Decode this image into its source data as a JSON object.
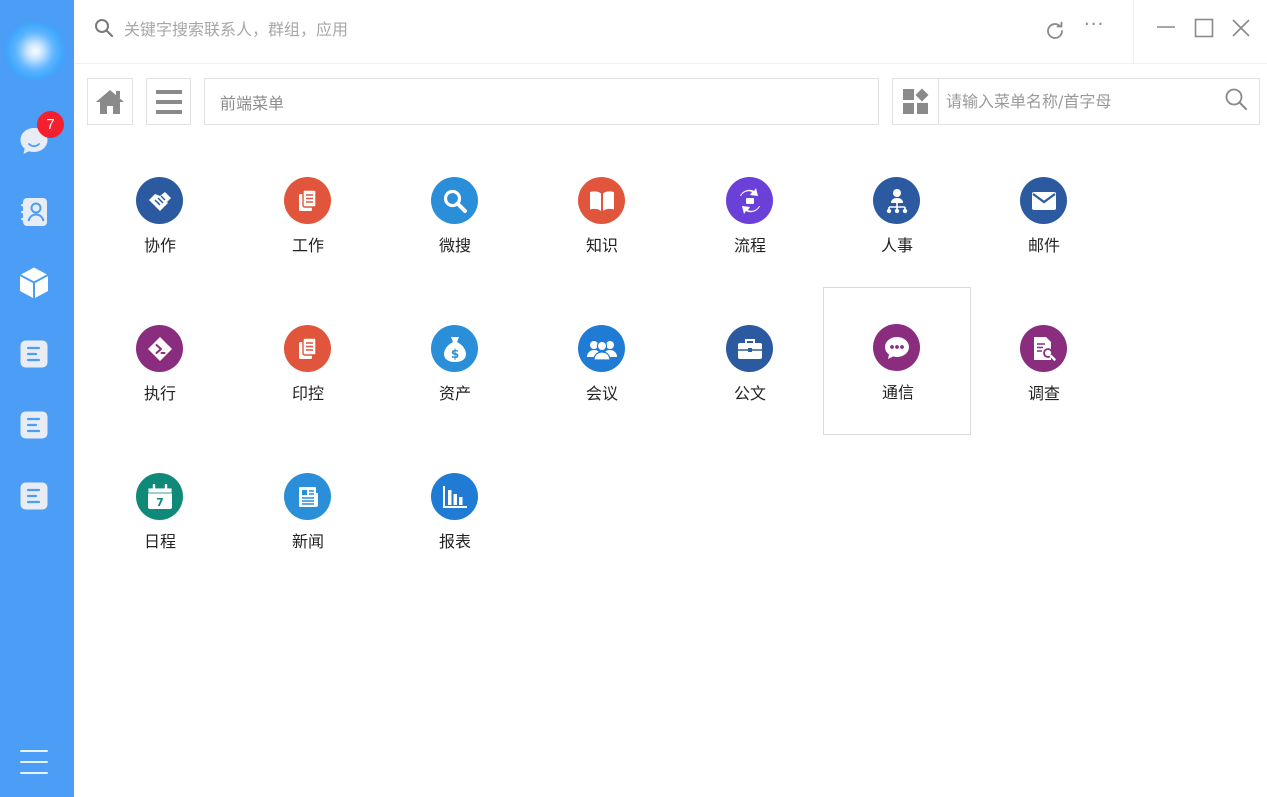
{
  "sidebar": {
    "badge_count": "7",
    "items": [
      {
        "icon": "chat-bubble-icon"
      },
      {
        "icon": "contacts-icon"
      },
      {
        "icon": "cube-icon"
      },
      {
        "icon": "document-icon"
      },
      {
        "icon": "document-icon"
      },
      {
        "icon": "document-icon"
      }
    ]
  },
  "titlebar": {
    "search_placeholder": "关键字搜索联系人，群组，应用",
    "more_label": "···"
  },
  "toolbar": {
    "breadcrumb": "前端菜单",
    "menu_search_placeholder": "请输入菜单名称/首字母"
  },
  "apps": [
    {
      "label": "协作",
      "color": "#2c5aa0",
      "icon": "handshake-icon"
    },
    {
      "label": "工作",
      "color": "#e0553b",
      "icon": "documents-icon"
    },
    {
      "label": "微搜",
      "color": "#2a8ed8",
      "icon": "magnifier-icon"
    },
    {
      "label": "知识",
      "color": "#e0553b",
      "icon": "book-icon"
    },
    {
      "label": "流程",
      "color": "#6a40d9",
      "icon": "flow-icon"
    },
    {
      "label": "人事",
      "color": "#2c5aa0",
      "icon": "org-chart-icon"
    },
    {
      "label": "邮件",
      "color": "#2c5aa0",
      "icon": "envelope-icon"
    },
    {
      "label": "执行",
      "color": "#8a2d7e",
      "icon": "execute-icon"
    },
    {
      "label": "印控",
      "color": "#e0553b",
      "icon": "documents-icon"
    },
    {
      "label": "资产",
      "color": "#2a8ed8",
      "icon": "money-bag-icon"
    },
    {
      "label": "会议",
      "color": "#1f7bd4",
      "icon": "people-icon"
    },
    {
      "label": "公文",
      "color": "#2c5aa0",
      "icon": "briefcase-icon"
    },
    {
      "label": "通信",
      "color": "#8a2d7e",
      "icon": "speech-bubble-icon"
    },
    {
      "label": "调查",
      "color": "#8a2d7e",
      "icon": "search-document-icon"
    },
    {
      "label": "日程",
      "color": "#0f8a78",
      "icon": "calendar-icon",
      "calendar_day": "7"
    },
    {
      "label": "新闻",
      "color": "#2a8ed8",
      "icon": "newspaper-icon"
    },
    {
      "label": "报表",
      "color": "#1f7bd4",
      "icon": "bar-chart-icon"
    }
  ],
  "selected_app": "通信"
}
